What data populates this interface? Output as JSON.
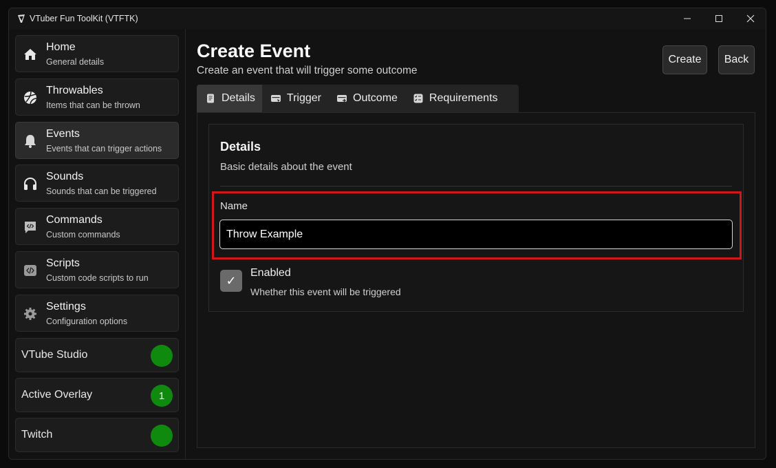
{
  "window": {
    "title": "VTuber Fun ToolKit (VTFTK)",
    "controls": [
      "minimize",
      "maximize",
      "close"
    ]
  },
  "sidebar": {
    "items": [
      {
        "title": "Home",
        "subtitle": "General details",
        "icon": "home-icon"
      },
      {
        "title": "Throwables",
        "subtitle": "Items that can be thrown",
        "icon": "ball-icon"
      },
      {
        "title": "Events",
        "subtitle": "Events that can trigger actions",
        "icon": "bell-icon",
        "active": true
      },
      {
        "title": "Sounds",
        "subtitle": "Sounds that can be triggered",
        "icon": "headphones-icon"
      },
      {
        "title": "Commands",
        "subtitle": "Custom commands",
        "icon": "code-bubble-icon"
      },
      {
        "title": "Scripts",
        "subtitle": "Custom code scripts to run",
        "icon": "code-icon"
      },
      {
        "title": "Settings",
        "subtitle": "Configuration options",
        "icon": "gear-icon"
      }
    ],
    "status": [
      {
        "label": "VTube Studio",
        "badge": "",
        "color": "#0f8a0f"
      },
      {
        "label": "Active Overlay",
        "badge": "1",
        "color": "#0f8a0f"
      },
      {
        "label": "Twitch",
        "badge": "",
        "color": "#0f8a0f"
      }
    ]
  },
  "main": {
    "title": "Create Event",
    "subtitle": "Create an event that will trigger some outcome",
    "buttons": {
      "create": "Create",
      "back": "Back"
    },
    "tabs": [
      {
        "label": "Details",
        "icon": "document-icon",
        "active": true
      },
      {
        "label": "Trigger",
        "icon": "trigger-icon"
      },
      {
        "label": "Outcome",
        "icon": "outcome-icon"
      },
      {
        "label": "Requirements",
        "icon": "checklist-icon"
      }
    ],
    "details": {
      "title": "Details",
      "subtitle": "Basic details about the event",
      "name_label": "Name",
      "name_value": "Throw Example",
      "enabled_label": "Enabled",
      "enabled_description": "Whether this event will be triggered",
      "enabled_checked": true,
      "checkmark": "✓"
    }
  },
  "colors": {
    "status_green": "#0f8a0f",
    "highlight_red": "#d01818",
    "background": "#121212"
  }
}
